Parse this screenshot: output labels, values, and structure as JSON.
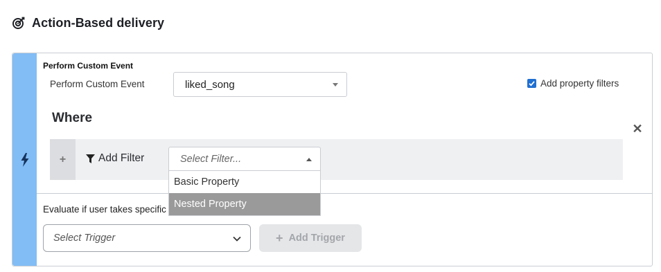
{
  "header": {
    "title": "Action-Based delivery",
    "icon": "target-icon"
  },
  "event": {
    "heading": "Perform Custom Event",
    "label": "Perform Custom Event",
    "selected_value": "liked_song",
    "add_property_filters_label": "Add property filters",
    "add_property_filters_checked": true
  },
  "where": {
    "heading": "Where",
    "add_filter_label": "Add Filter",
    "filter_placeholder": "Select Filter...",
    "filter_options": [
      "Basic Property",
      "Nested Property"
    ],
    "hovered_option": "Nested Property"
  },
  "trigger": {
    "eval_text": "Evaluate if user takes specific",
    "select_placeholder": "Select Trigger",
    "add_trigger_label": "Add Trigger"
  },
  "colors": {
    "stripe": "#82bdf6",
    "checkbox": "#1f6fd1",
    "hover_option": "#9a9a9a"
  }
}
